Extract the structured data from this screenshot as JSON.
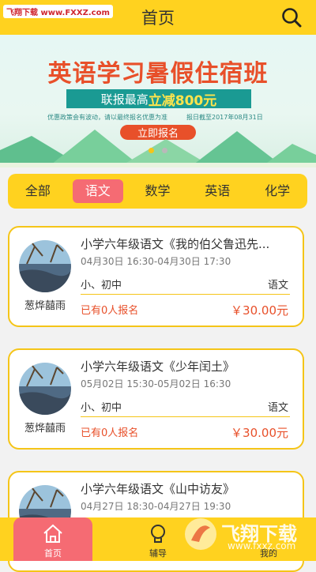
{
  "header": {
    "title": "首页",
    "watermark": "飞翔下载 www.FXXZ.com"
  },
  "banner": {
    "headline": "英语学习暑假住宿班",
    "ribbon_prefix": "联报最高",
    "ribbon_highlight": "立减800元",
    "note_left": "优惠政策会有波动，请以最终报名优惠为准",
    "note_right": "报日截至2017年08月31日",
    "button": "立即报名",
    "slide_count": 2,
    "active_slide": 1
  },
  "filter": {
    "tabs": [
      "全部",
      "语文",
      "数学",
      "英语",
      "化学"
    ],
    "active_index": 1
  },
  "courses": [
    {
      "title": "小学六年级语文《我的伯父鲁迅先...",
      "time": "04月30日 16:30-04月30日 17:30",
      "grade": "小、初中",
      "subject": "语文",
      "enrolled": "已有0人报名",
      "price": "￥30.00元",
      "author": "葱烨囍雨"
    },
    {
      "title": "小学六年级语文《少年闰土》",
      "time": "05月02日 15:30-05月02日 16:30",
      "grade": "小、初中",
      "subject": "语文",
      "enrolled": "已有0人报名",
      "price": "￥30.00元",
      "author": "葱烨囍雨"
    },
    {
      "title": "小学六年级语文《山中访友》",
      "time": "04月27日 18:30-04月27日 19:30",
      "grade": "",
      "subject": "",
      "enrolled": "",
      "price": "",
      "author": ""
    }
  ],
  "tabbar": {
    "items": [
      {
        "label": "首页",
        "icon": "home-icon"
      },
      {
        "label": "辅导",
        "icon": "lightbulb-icon"
      },
      {
        "label": "",
        "icon": ""
      },
      {
        "label": "我的",
        "icon": "user-icon"
      }
    ],
    "active_index": 0
  },
  "watermark_br": {
    "text": "飞翔下载",
    "url": "www.fxxz.com"
  },
  "colors": {
    "primary": "#ffd21f",
    "accent": "#f56b73",
    "price": "#e8502a",
    "card_border": "#f5c518"
  }
}
